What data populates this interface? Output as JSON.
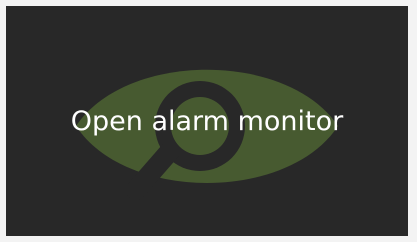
{
  "tile": {
    "label": "Open alarm monitor",
    "icon": "eye-monitor-icon",
    "background_color": "#282828",
    "icon_color": "#475a30",
    "text_color": "#ffffff"
  }
}
